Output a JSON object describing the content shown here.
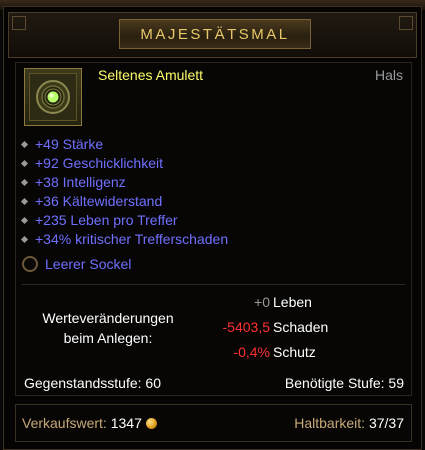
{
  "header": {
    "title": "MAJESTÄTSMAL"
  },
  "item": {
    "name": "Seltenes Amulett",
    "slot": "Hals",
    "name_color": "#fdfd6b",
    "icon": "amulet-icon"
  },
  "affixes": [
    "+49 Stärke",
    "+92 Geschicklichkeit",
    "+38 Intelligenz",
    "+36 Kältewiderstand",
    "+235 Leben pro Treffer",
    "+34% kritischer Trefferschaden"
  ],
  "socket": {
    "label": "Leerer Sockel"
  },
  "comparison": {
    "label_line1": "Werteveränderungen",
    "label_line2": "beim Anlegen:",
    "rows": [
      {
        "value": "+0",
        "name": "Leben",
        "color": "#9a9a9a"
      },
      {
        "value": "-5403,5",
        "name": "Schaden",
        "color": "#ff3030"
      },
      {
        "value": "-0,4%",
        "name": "Schutz",
        "color": "#ff3030"
      }
    ]
  },
  "stats": {
    "item_level": "Gegenstandsstufe: 60",
    "required_level": "Benötigte Stufe: 59"
  },
  "footer": {
    "sell_label": "Verkaufswert:",
    "sell_value": "1347",
    "durability_label": "Haltbarkeit:",
    "durability_value": "37/37"
  },
  "colors": {
    "affix": "#7070ff",
    "label_gold": "#c8a878",
    "negative": "#ff3030"
  }
}
